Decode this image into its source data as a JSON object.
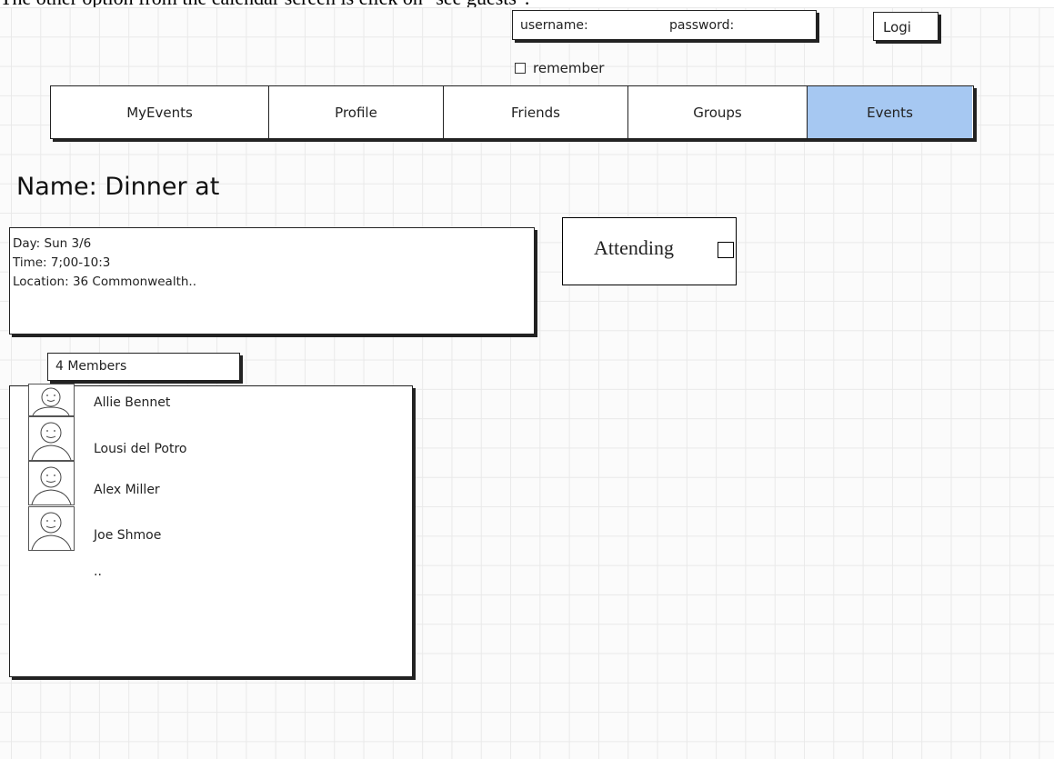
{
  "caption": "The other option from the calendar screen is click on \"see guests\".",
  "login": {
    "username_label": "username:",
    "password_label": "password:",
    "login_button": "Logi",
    "remember_label": "remember"
  },
  "nav": {
    "tabs": [
      {
        "label": "MyEvents",
        "active": false
      },
      {
        "label": "Profile",
        "active": false
      },
      {
        "label": "Friends",
        "active": false
      },
      {
        "label": "Groups",
        "active": false
      },
      {
        "label": "Events",
        "active": true
      }
    ],
    "active_color": "#a6c8f2"
  },
  "event": {
    "title": "Name: Dinner at",
    "day": "Day: Sun 3/6",
    "time": "Time: 7;00-10:3",
    "location": "Location: 36 Commonwealth.."
  },
  "attending": {
    "label": "Attending",
    "checked": false
  },
  "members": {
    "header": "4 Members",
    "list": [
      {
        "name": "Allie Bennet",
        "avatar": "person-icon"
      },
      {
        "name": "Lousi del Potro",
        "avatar": "person-icon"
      },
      {
        "name": "Alex Miller",
        "avatar": "person-icon"
      },
      {
        "name": "Joe Shmoe",
        "avatar": "person-icon"
      }
    ],
    "more": ".."
  }
}
